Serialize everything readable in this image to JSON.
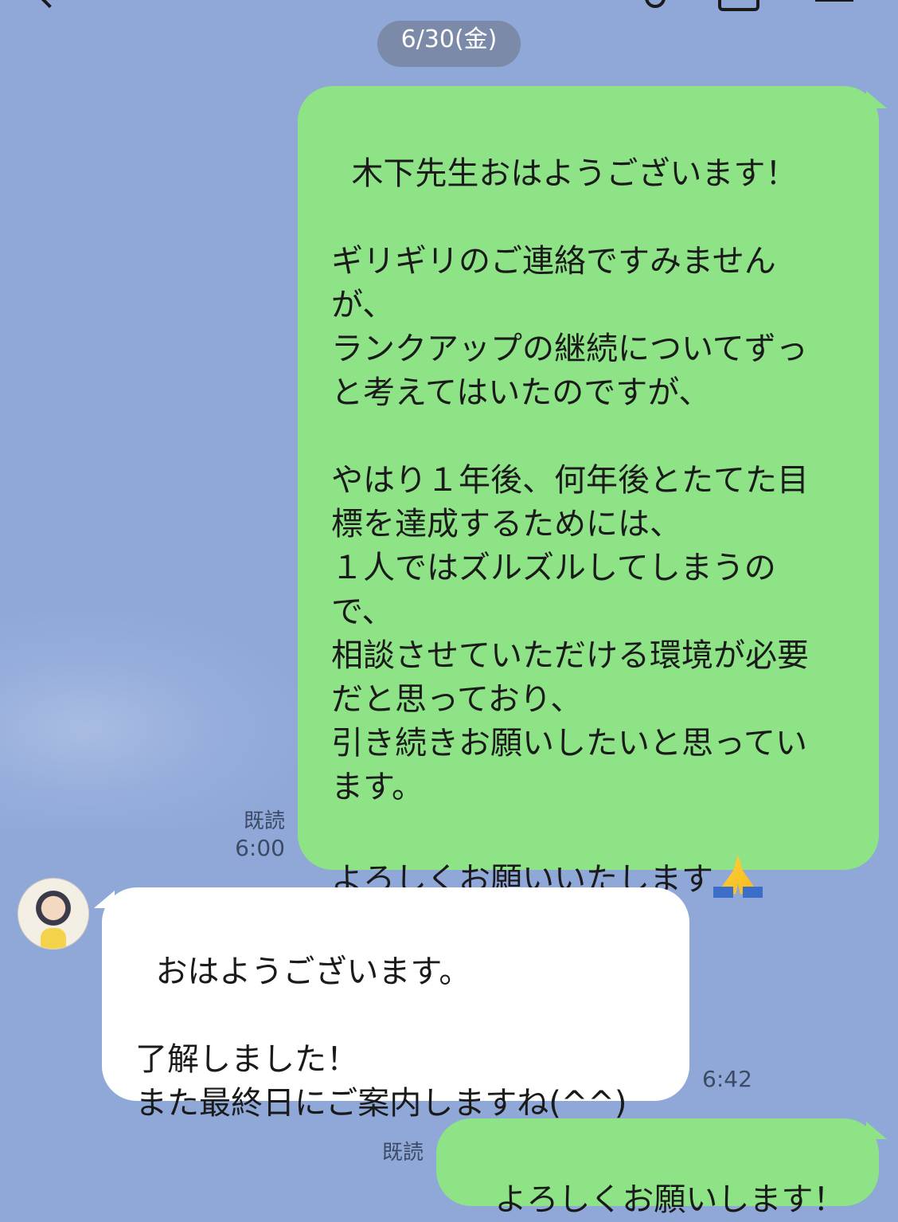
{
  "header": {
    "back_icon": "chevron-left-icon",
    "search_icon": "search-icon",
    "call_icon": "phone-icon",
    "menu_icon": "menu-icon"
  },
  "date_separator": "6/30(金)",
  "messages": [
    {
      "direction": "outgoing",
      "text": "木下先生おはようございます！\n\nギリギリのご連絡ですみません\nが、\nランクアップの継続についてずっ\nと考えてはいたのですが、\n\nやはり１年後、何年後とたてた目\n標を達成するためには、\n１人ではズルズルしてしまうの\nで、\n相談させていただける環境が必要\nだと思っており、\n引き続きお願いしたいと思ってい\nます。\n\nよろしくお願いいたします",
      "emoji": "folded-hands-icon",
      "read_label": "既読",
      "time": "6:00"
    },
    {
      "direction": "incoming",
      "text": "おはようございます。\n\n了解しました！\nまた最終日にご案内しますね(^^)",
      "time": "6:42"
    },
    {
      "direction": "outgoing",
      "text": "よろしくお願いします！",
      "read_label": "既読"
    }
  ],
  "colors": {
    "background": "#8fa8d8",
    "outgoing_bubble": "#8de386",
    "incoming_bubble": "#ffffff",
    "date_pill": "#7a8aa8"
  }
}
